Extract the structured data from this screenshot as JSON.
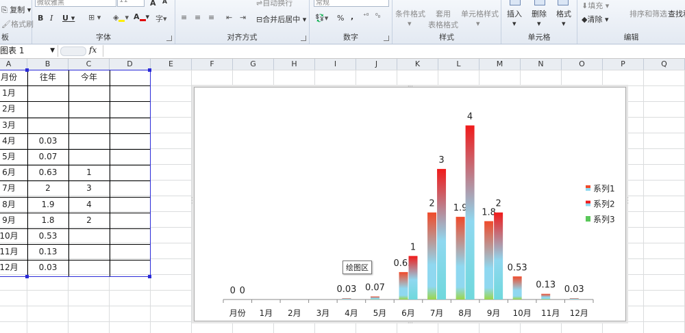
{
  "ribbon": {
    "clipboard": {
      "copy_label": "复制",
      "format_painter_label": "格式刷",
      "group_label": "板"
    },
    "font": {
      "group_label": "字体",
      "font_name": "微软雅黑",
      "font_size": "11",
      "bold": "B",
      "italic": "I",
      "underline": "U"
    },
    "alignment": {
      "group_label": "对齐方式",
      "wrap_label": "自动换行",
      "merge_label": "合并后居中"
    },
    "number": {
      "group_label": "数字",
      "format_value": "常规",
      "percent": "%",
      "comma": ","
    },
    "styles": {
      "group_label": "样式",
      "conditional_label": "条件格式",
      "table_label": "套用\n表格格式",
      "cell_style_label": "单元格样式"
    },
    "cells": {
      "group_label": "单元格",
      "insert_label": "插入",
      "delete_label": "删除",
      "format_label": "格式"
    },
    "editing": {
      "group_label": "编辑",
      "fill_label": "填充",
      "clear_label": "清除",
      "sort_label": "排序和筛选",
      "find_label": "查找和"
    }
  },
  "formula_bar": {
    "name_box": "图表 1",
    "fx": "fx",
    "formula": ""
  },
  "columns": [
    "A",
    "B",
    "C",
    "D",
    "E",
    "F",
    "G",
    "H",
    "I",
    "J",
    "K",
    "L",
    "M",
    "N",
    "O",
    "P",
    "Q"
  ],
  "table": {
    "headers": [
      "月份",
      "往年",
      "今年"
    ],
    "rows": [
      [
        "1月",
        "",
        ""
      ],
      [
        "2月",
        "",
        ""
      ],
      [
        "3月",
        "",
        ""
      ],
      [
        "4月",
        "0.03",
        ""
      ],
      [
        "5月",
        "0.07",
        ""
      ],
      [
        "6月",
        "0.63",
        "1"
      ],
      [
        "7月",
        "2",
        "3"
      ],
      [
        "8月",
        "1.9",
        "4"
      ],
      [
        "9月",
        "1.8",
        "2"
      ],
      [
        "10月",
        "0.53",
        ""
      ],
      [
        "11月",
        "0.13",
        ""
      ],
      [
        "12月",
        "0.03",
        ""
      ]
    ]
  },
  "tooltip": "绘图区",
  "chart_data": {
    "type": "bar",
    "categories": [
      "月份",
      "1月",
      "2月",
      "3月",
      "4月",
      "5月",
      "6月",
      "7月",
      "8月",
      "9月",
      "10月",
      "11月",
      "12月"
    ],
    "series": [
      {
        "name": "系列1",
        "values": [
          0,
          null,
          null,
          null,
          0.03,
          0.07,
          0.63,
          2,
          1.9,
          1.8,
          0.53,
          0.13,
          0.03
        ]
      },
      {
        "name": "系列2",
        "values": [
          0,
          null,
          null,
          null,
          null,
          null,
          1,
          3,
          4,
          2,
          null,
          null,
          null
        ]
      },
      {
        "name": "系列3",
        "values": [
          null,
          null,
          null,
          null,
          null,
          null,
          null,
          null,
          null,
          null,
          null,
          null,
          null
        ]
      }
    ],
    "data_labels": [
      [
        "0",
        null,
        null,
        null,
        "0.03",
        "0.07",
        "0.63",
        "2",
        "1.9",
        "1.8",
        "0.53",
        "0.13",
        "0.03"
      ],
      [
        "0",
        null,
        null,
        null,
        null,
        null,
        "1",
        "3",
        "4",
        "2",
        null,
        null,
        null
      ]
    ],
    "ylim": [
      0,
      4.4
    ],
    "legend_position": "right",
    "grid": false,
    "colors": {
      "series1_top": "#f04a2a",
      "series2_top": "#f01a1a",
      "mid": "#8fd8f0",
      "bottom": "#9ad64a",
      "series3": "#5ac85a"
    }
  },
  "selection_color": "#2a2ad8"
}
